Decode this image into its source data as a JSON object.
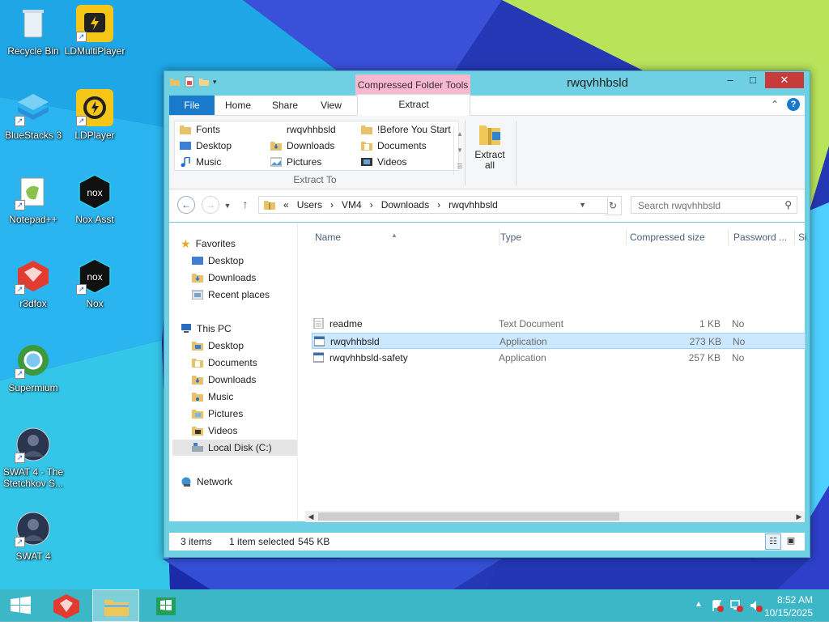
{
  "desktop_icons": [
    {
      "label": "Recycle Bin"
    },
    {
      "label": "LDMultiPlayer"
    },
    {
      "label": "BlueStacks 3"
    },
    {
      "label": "LDPlayer"
    },
    {
      "label": "Notepad++"
    },
    {
      "label": "Nox Asst"
    },
    {
      "label": "r3dfox"
    },
    {
      "label": "Nox"
    },
    {
      "label": "Supermium"
    },
    {
      "label": "SWAT 4 - The Stetchkov S..."
    },
    {
      "label": "SWAT 4"
    }
  ],
  "window": {
    "title": "rwqvhhbsld",
    "contextual_group": "Compressed Folder Tools",
    "controls": {
      "minimize": "–",
      "maximize": "□",
      "close": "✕"
    },
    "tabs": {
      "file": "File",
      "home": "Home",
      "share": "Share",
      "view": "View",
      "extract": "Extract"
    }
  },
  "ribbon": {
    "extract_to_items": [
      "Fonts",
      "rwqvhhbsld",
      "!Before You Start",
      "Desktop",
      "Downloads",
      "Documents",
      "Music",
      "Pictures",
      "Videos"
    ],
    "extract_to_label": "Extract To",
    "extract_all_label_line1": "Extract",
    "extract_all_label_line2": "all"
  },
  "address": {
    "prefix": "«",
    "crumbs": [
      "Users",
      "VM4",
      "Downloads",
      "rwqvhhbsld"
    ],
    "sep": "›",
    "search_placeholder": "Search rwqvhhbsld"
  },
  "navpane": {
    "favorites": "Favorites",
    "fav_items": [
      "Desktop",
      "Downloads",
      "Recent places"
    ],
    "thispc": "This PC",
    "pc_items": [
      "Desktop",
      "Documents",
      "Downloads",
      "Music",
      "Pictures",
      "Videos",
      "Local Disk (C:)"
    ],
    "network": "Network"
  },
  "columns": {
    "name": "Name",
    "type": "Type",
    "csize": "Compressed size",
    "password": "Password ...",
    "size": "Si"
  },
  "files": [
    {
      "name": "readme",
      "type": "Text Document",
      "csize": "1 KB",
      "password": "No"
    },
    {
      "name": "rwqvhhbsld",
      "type": "Application",
      "csize": "273 KB",
      "password": "No"
    },
    {
      "name": "rwqvhhbsld-safety",
      "type": "Application",
      "csize": "257 KB",
      "password": "No"
    }
  ],
  "status": {
    "items": "3 items",
    "selected": "1 item selected",
    "size": "545 KB"
  },
  "taskbar": {
    "time": "8:52 AM",
    "date": "10/15/2025"
  },
  "colors": {
    "accent": "#1979ca",
    "window_border": "#6fd0e4",
    "taskbar": "#3bb7c8",
    "context_tab": "#f7b9d0",
    "selection": "#cce8ff"
  }
}
